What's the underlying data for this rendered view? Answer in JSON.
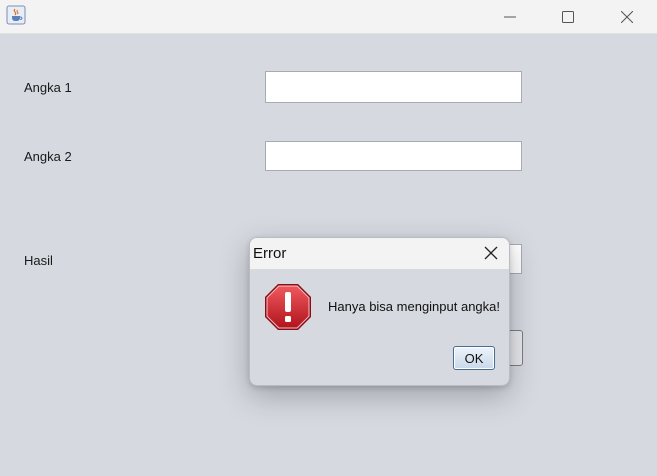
{
  "window": {
    "icon": "java-cup-icon",
    "controls": [
      "minimize-icon",
      "maximize-icon",
      "close-icon"
    ]
  },
  "form": {
    "angka1_label": "Angka 1",
    "angka1_value": "",
    "angka2_label": "Angka 2",
    "angka2_value": "",
    "hasil_label": "Hasil",
    "hasil_value": ""
  },
  "dialog": {
    "title": "Error",
    "message": "Hanya bisa menginput angka!",
    "ok_label": "OK",
    "icon": "error-octagon-icon",
    "icon_color": "#c8202a"
  }
}
